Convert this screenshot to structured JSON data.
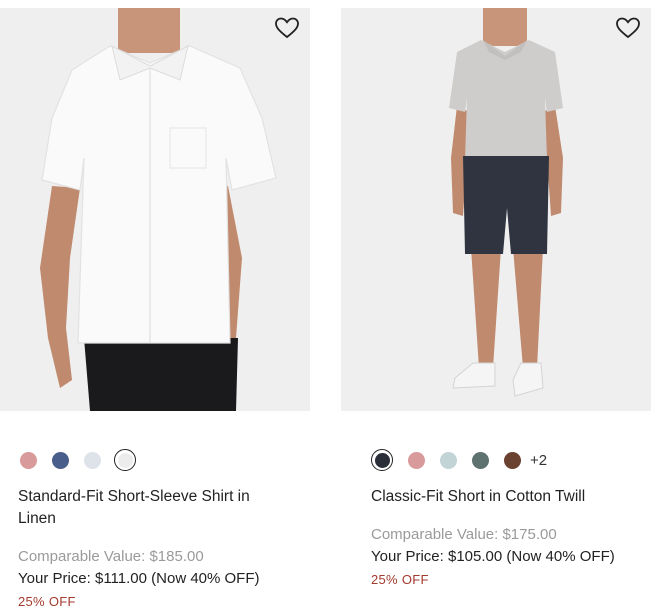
{
  "products": [
    {
      "title": "Standard-Fit Short-Sleeve Shirt in Linen",
      "comparable_value": "Comparable Value: $185.00",
      "your_price": "Your Price: $111.00 (Now 40% OFF)",
      "discount": "25% OFF",
      "swatches": [
        "#d89a9a",
        "#4a5e8c",
        "#dde3e8",
        "#ececec"
      ],
      "selected_swatch": 3,
      "wishlist_icon": "heart-outline-icon"
    },
    {
      "title": "Classic-Fit Short in Cotton Twill",
      "comparable_value": "Comparable Value: $175.00",
      "your_price": "Your Price: $105.00 (Now 40% OFF)",
      "discount": "25% OFF",
      "swatches": [
        "#2a2e38",
        "#d89a9a",
        "#c2d4d6",
        "#5e736f",
        "#6b4130"
      ],
      "selected_swatch": 0,
      "more_colors": "+2",
      "wishlist_icon": "heart-outline-icon"
    }
  ]
}
